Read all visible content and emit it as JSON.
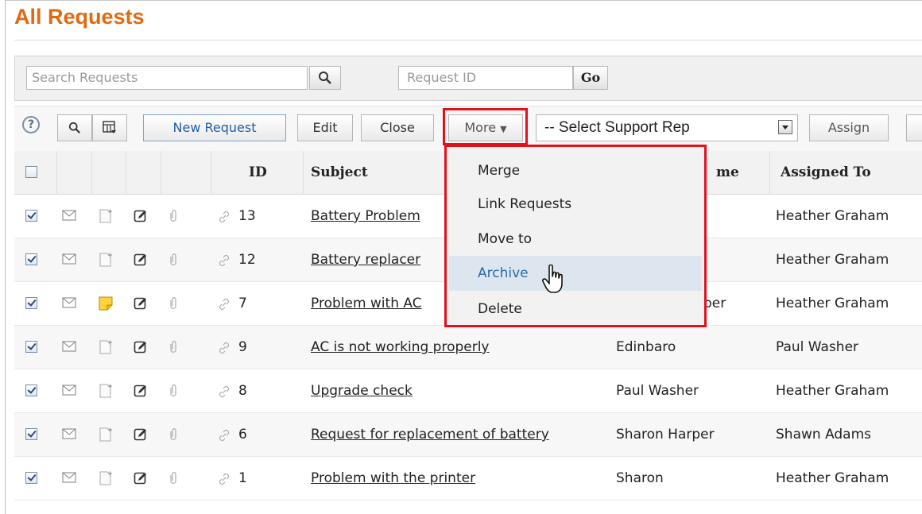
{
  "page": {
    "title": "All Requests"
  },
  "search": {
    "placeholder": "Search Requests",
    "request_id_placeholder": "Request ID",
    "go_label": "Go"
  },
  "toolbar": {
    "new_request": "New Request",
    "edit": "Edit",
    "close": "Close",
    "more": "More",
    "select_rep": "-- Select Support Rep",
    "assign": "Assign"
  },
  "more_menu": {
    "items": [
      "Merge",
      "Link Requests",
      "Move to",
      "Archive",
      "Delete"
    ],
    "hovered": "Archive"
  },
  "table": {
    "headers": {
      "id": "ID",
      "subject": "Subject",
      "requester": "me",
      "assigned": "Assigned To"
    },
    "rows": [
      {
        "id": "13",
        "subject": "Battery Problem",
        "requester": "",
        "assigned": "Heather Graham",
        "checked": true,
        "note": false
      },
      {
        "id": "12",
        "subject": "Battery replacer",
        "requester": "",
        "assigned": "Heather Graham",
        "checked": true,
        "note": false
      },
      {
        "id": "7",
        "subject": "Problem with AC",
        "requester": "rper",
        "assigned": "Heather Graham",
        "checked": true,
        "note": true
      },
      {
        "id": "9",
        "subject": "AC is not working properly",
        "requester": "Edinbaro",
        "assigned": "Paul Washer",
        "checked": true,
        "note": false
      },
      {
        "id": "8",
        "subject": "Upgrade check",
        "requester": "Paul Washer",
        "assigned": "Heather Graham",
        "checked": true,
        "note": false
      },
      {
        "id": "6",
        "subject": "Request for replacement of battery",
        "requester": "Sharon Harper",
        "assigned": "Shawn Adams",
        "checked": true,
        "note": false
      },
      {
        "id": "1",
        "subject": "Problem with the printer",
        "requester": "Sharon",
        "assigned": "Heather Graham",
        "checked": true,
        "note": false
      }
    ]
  },
  "colors": {
    "title": "#e06a10",
    "highlight": "#e3101c",
    "link_blue": "#1f5fa8"
  },
  "icons": [
    "help-icon",
    "search-icon",
    "column-chooser-icon",
    "mail-icon",
    "add-note-icon",
    "edit-icon",
    "attachment-icon",
    "link-icon",
    "hand-cursor-icon",
    "caret-down-icon"
  ]
}
